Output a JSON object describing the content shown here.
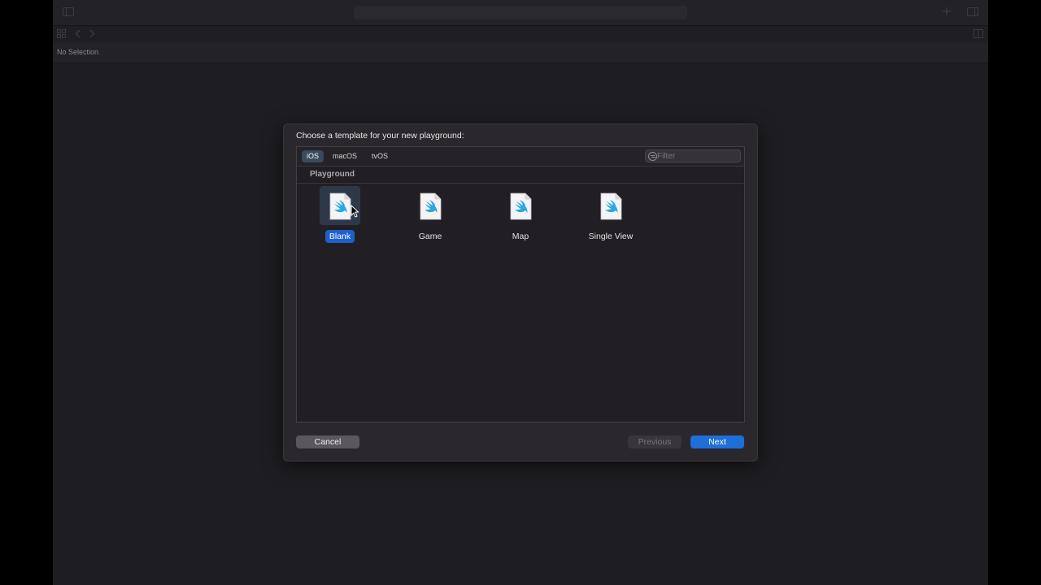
{
  "editor": {
    "no_selection_label": "No Selection"
  },
  "sheet": {
    "title": "Choose a template for your new playground:",
    "platform_tabs": [
      {
        "label": "iOS",
        "selected": true
      },
      {
        "label": "macOS",
        "selected": false
      },
      {
        "label": "tvOS",
        "selected": false
      }
    ],
    "filter": {
      "placeholder": "Filter",
      "value": "",
      "icon": "filter-icon"
    },
    "section_label": "Playground",
    "templates": [
      {
        "label": "Blank",
        "selected": true,
        "icon": "swift-file-icon"
      },
      {
        "label": "Game",
        "selected": false,
        "icon": "swift-file-icon"
      },
      {
        "label": "Map",
        "selected": false,
        "icon": "swift-file-icon"
      },
      {
        "label": "Single View",
        "selected": false,
        "icon": "swift-file-icon"
      }
    ],
    "buttons": {
      "cancel": "Cancel",
      "previous": "Previous",
      "next": "Next"
    }
  },
  "colors": {
    "accent": "#1f6fd8",
    "swift_icon": "#2aa8e0"
  }
}
